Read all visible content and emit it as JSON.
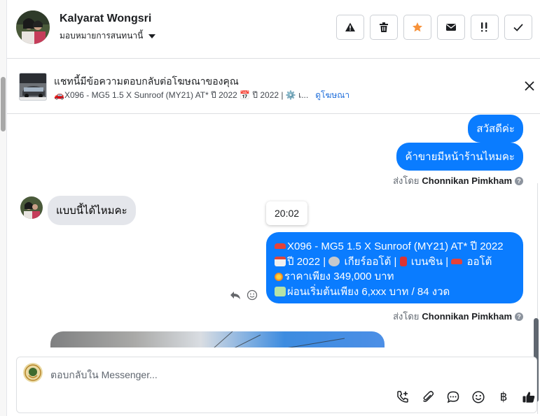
{
  "header": {
    "contact_name": "Kalyarat Wongsri",
    "assign_label": "มอบหมายการสนทนานี้",
    "actions": [
      {
        "name": "spam-button",
        "icon": "warning-icon"
      },
      {
        "name": "delete-button",
        "icon": "trash-icon"
      },
      {
        "name": "star-button",
        "icon": "star-icon"
      },
      {
        "name": "mark-unread-button",
        "icon": "envelope-icon"
      },
      {
        "name": "follow-up-button",
        "icon": "priority-icon"
      },
      {
        "name": "done-button",
        "icon": "check-icon"
      }
    ],
    "star_color": "#f7923a"
  },
  "ad_banner": {
    "title": "แชทนี้มีข้อความตอบกลับต่อโฆษณาของคุณ",
    "description": "🚗X096 - MG5 1.5 X Sunroof (MY21) AT* ปี 2022 📅 ปี 2022 | ⚙️ เ...",
    "view_ad_link": "ดูโฆษณา"
  },
  "messages": {
    "out_1": "สวัสดีค่ะ",
    "out_2": "ค้าขายมีหน้าร้านไหมคะ",
    "sent_by_prefix": "ส่งโดย",
    "sent_by_name": "Chonnikan Pimkham",
    "in_1": "แบบนี้ได้ไหมคะ",
    "timestamp": "20:02",
    "out_3_lines": [
      "X096 -  MG5 1.5 X Sunroof (MY21) AT* ปี 2022",
      "ปี 2022 | ",
      " เกียร์ออโต้ | ",
      " เบนซิน | ",
      " ออโต้",
      "ราคาเพียง 349,000 บาท",
      "ผ่อนเริ่มต้นเพียง 6,xxx บาท / 84 งวด"
    ],
    "sent_by_name_2": "Chonnikan Pimkham"
  },
  "composer": {
    "placeholder": "ตอบกลับใน Messenger...",
    "tools": [
      "call-add-icon",
      "attachment-icon",
      "chat-bubble-icon",
      "emoji-icon",
      "baht-icon",
      "thumbs-up-icon"
    ],
    "baht_symbol": "฿"
  },
  "colors": {
    "bubble_out": "#0a7cff",
    "bubble_in": "#e4e6eb",
    "link": "#216fdb"
  }
}
